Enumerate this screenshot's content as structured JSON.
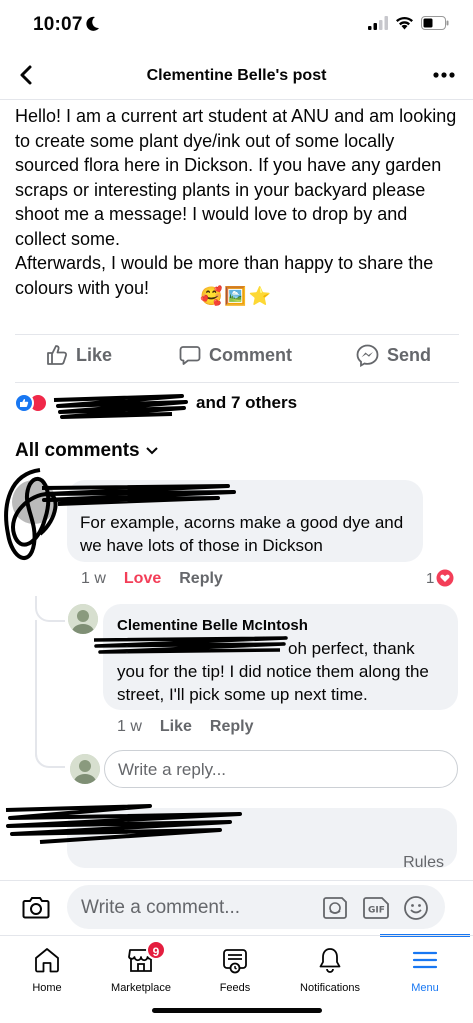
{
  "status": {
    "time": "10:07"
  },
  "nav": {
    "title": "Clementine Belle's post"
  },
  "post": {
    "text": "Hello! I am a current art student at ANU and am looking to create some plant dye/ink out of some locally sourced flora here in Dickson. If you have any garden scraps or interesting plants in your backyard please shoot me a message! I would love to drop by and collect some.\nAfterwards, I would be more than happy to share the colours with you!",
    "emoji": [
      "🥰",
      "🖼️",
      "⭐"
    ]
  },
  "actions": {
    "like": "Like",
    "comment": "Comment",
    "send": "Send"
  },
  "reactions": {
    "summary_suffix": "and 7 others"
  },
  "comments_header": {
    "label": "All comments"
  },
  "comment1": {
    "text": "For example, acorns make a good dye and we have lots of those in Dickson",
    "age": "1 w",
    "love_label": "Love",
    "reply_label": "Reply",
    "reaction_count": "1"
  },
  "reply1": {
    "author": "Clementine Belle McIntosh",
    "text_line1": "oh perfect, thank",
    "text_rest": "you for the tip! I did notice them along the street, I'll pick some up next time.",
    "age": "1 w",
    "like_label": "Like",
    "reply_label": "Reply"
  },
  "reply_box": {
    "placeholder": "Write a reply..."
  },
  "rules": {
    "label": "Rules"
  },
  "composer": {
    "placeholder": "Write a comment..."
  },
  "tabs": [
    {
      "label": "Home"
    },
    {
      "label": "Marketplace",
      "badge": "9"
    },
    {
      "label": "Feeds"
    },
    {
      "label": "Notifications"
    },
    {
      "label": "Menu"
    }
  ],
  "colors": {
    "accent": "#1877f2",
    "love": "#f33e58",
    "muted": "#65676b"
  }
}
